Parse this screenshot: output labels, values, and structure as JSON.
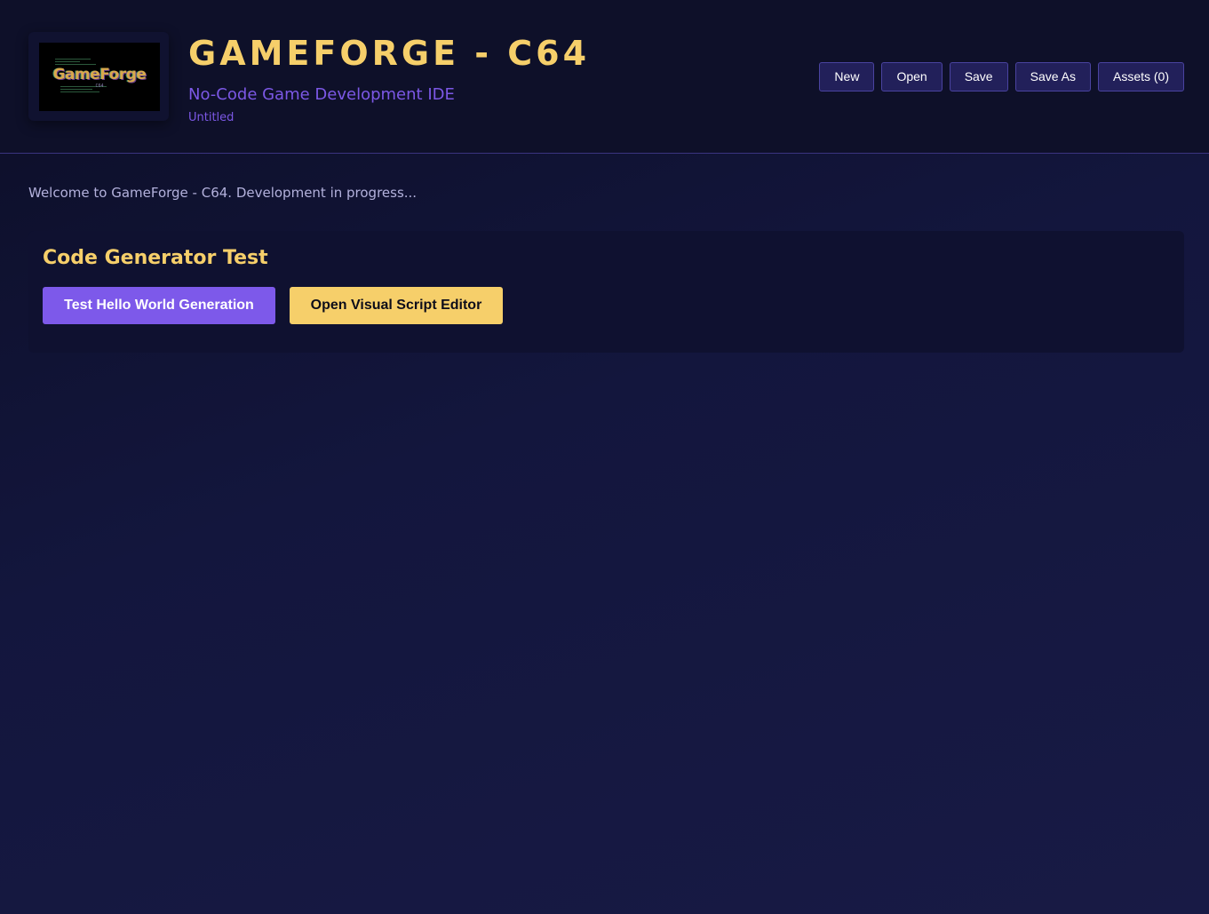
{
  "header": {
    "logo": {
      "text": "GameForge",
      "subtext": "C64"
    },
    "title": "GAMEFORGE - C64",
    "subtitle": "No-Code Game Development IDE",
    "filename": "Untitled"
  },
  "toolbar": {
    "new_label": "New",
    "open_label": "Open",
    "save_label": "Save",
    "save_as_label": "Save As",
    "assets_label": "Assets (0)"
  },
  "main": {
    "welcome": "Welcome to GameForge - C64. Development in progress...",
    "panel": {
      "title": "Code Generator Test",
      "test_button_label": "Test Hello World Generation",
      "editor_button_label": "Open Visual Script Editor"
    }
  },
  "colors": {
    "accent_yellow": "#f6cf6a",
    "accent_purple": "#7d59ea",
    "toolbar_button_bg": "#22205a",
    "background": "#13163d"
  }
}
